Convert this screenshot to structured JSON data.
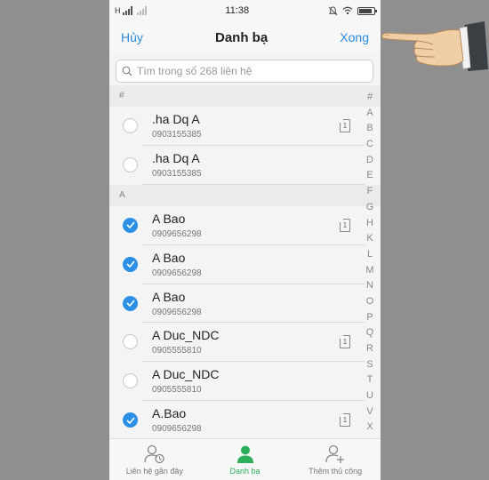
{
  "status": {
    "carrier": "H",
    "time": "11:38"
  },
  "nav": {
    "cancel": "Hủy",
    "title": "Danh bạ",
    "done": "Xong"
  },
  "search": {
    "placeholder": "Tìm trong số 268 liên hệ"
  },
  "sections": [
    {
      "header": "#",
      "contacts": [
        {
          "name": ".ha Dq A",
          "phone": "0903155385",
          "checked": false,
          "sim": true
        },
        {
          "name": ".ha Dq A",
          "phone": "0903155385",
          "checked": false,
          "sim": false
        }
      ]
    },
    {
      "header": "A",
      "contacts": [
        {
          "name": "A Bao",
          "phone": "0909656298",
          "checked": true,
          "sim": true
        },
        {
          "name": "A Bao",
          "phone": "0909656298",
          "checked": true,
          "sim": false
        },
        {
          "name": "A Bao",
          "phone": "0909656298",
          "checked": true,
          "sim": false
        },
        {
          "name": "A Duc_NDC",
          "phone": "0905555810",
          "checked": false,
          "sim": true
        },
        {
          "name": "A Duc_NDC",
          "phone": "0905555810",
          "checked": false,
          "sim": false
        },
        {
          "name": "A.Bao",
          "phone": "0909656298",
          "checked": true,
          "sim": true
        }
      ]
    }
  ],
  "sim_label": "1",
  "index_letters": [
    "#",
    "A",
    "B",
    "C",
    "D",
    "E",
    "F",
    "G",
    "H",
    "K",
    "L",
    "M",
    "N",
    "O",
    "P",
    "Q",
    "R",
    "S",
    "T",
    "U",
    "V",
    "X"
  ],
  "tabs": [
    {
      "label": "Liên hệ gần đây",
      "icon": "recent-contacts-icon",
      "active": false
    },
    {
      "label": "Danh bạ",
      "icon": "contacts-icon",
      "active": true
    },
    {
      "label": "Thêm thủ công",
      "icon": "add-contact-icon",
      "active": false
    }
  ],
  "colors": {
    "accent": "#2a8adf",
    "check": "#2b8fe6",
    "active_tab": "#2dae5a"
  }
}
